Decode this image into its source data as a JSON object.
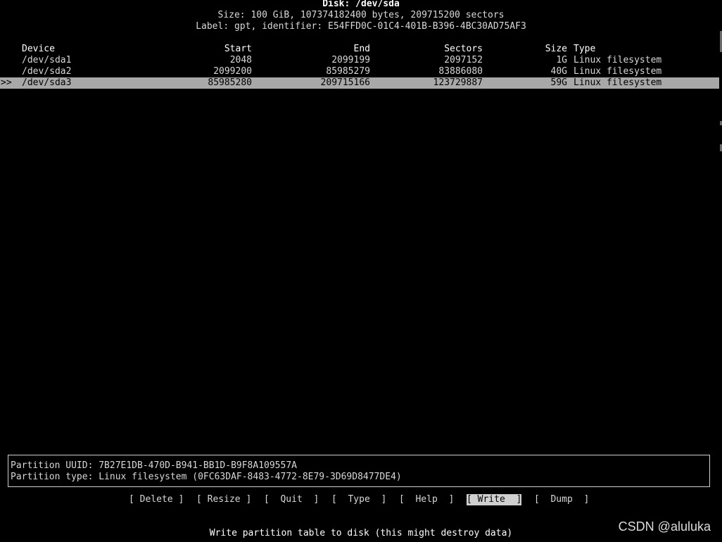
{
  "header": {
    "title": "Disk: /dev/sda",
    "size_line": "Size: 100 GiB, 107374182400 bytes, 209715200 sectors",
    "label_line": "Label: gpt, identifier: E54FFD0C-01C4-401B-B396-4BC30AD75AF3"
  },
  "table": {
    "columns": [
      "Device",
      "Start",
      "End",
      "Sectors",
      "Size",
      "Type"
    ],
    "pointer": ">>",
    "rows": [
      {
        "device": "/dev/sda1",
        "start": "2048",
        "end": "2099199",
        "sectors": "2097152",
        "size": "1G",
        "type": "Linux filesystem"
      },
      {
        "device": "/dev/sda2",
        "start": "2099200",
        "end": "85985279",
        "sectors": "83886080",
        "size": "40G",
        "type": "Linux filesystem"
      },
      {
        "device": "/dev/sda3",
        "start": "85985280",
        "end": "209715166",
        "sectors": "123729887",
        "size": "59G",
        "type": "Linux filesystem"
      }
    ]
  },
  "info": {
    "uuid_line": "Partition UUID: 7B27E1DB-470D-B941-BB1D-B9F8A109557A",
    "type_line": "Partition type: Linux filesystem (0FC63DAF-8483-4772-8E79-3D69D8477DE4)"
  },
  "menu": {
    "items": [
      "[ Delete ]",
      "[ Resize ]",
      "[  Quit  ]",
      "[  Type  ]",
      "[  Help  ]",
      "[ Write  ]",
      "[  Dump  ]"
    ],
    "active": "Write"
  },
  "hint": "Write partition table to disk (this might destroy data)",
  "watermark": "CSDN @aluluka",
  "colors": {
    "background": "#000000",
    "text": "#d8d8d8",
    "selected_row_bg": "#a8a8a8",
    "active_menu_bg": "#cfcfcf"
  }
}
